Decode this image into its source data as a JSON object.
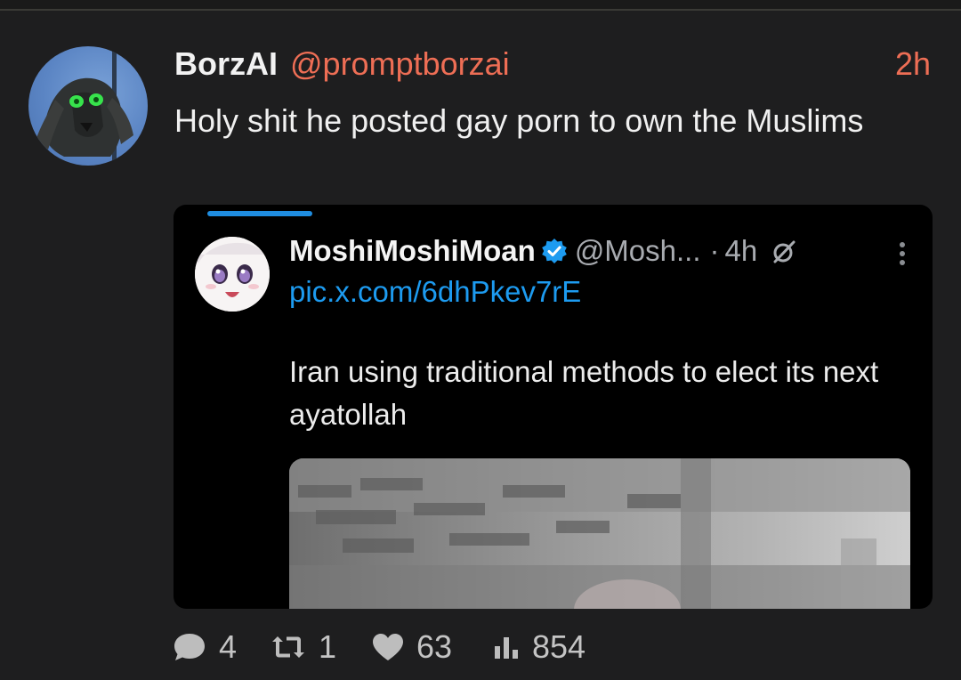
{
  "post": {
    "author": {
      "display_name": "BorzAI",
      "handle": "@promptborzai"
    },
    "timestamp": "2h",
    "text": "Holy shit he posted gay porn to own the Muslims",
    "embed": {
      "author": {
        "display_name": "MoshiMoshiMoan",
        "handle": "@Mosh...",
        "separator": "·",
        "time": "4h"
      },
      "link": "pic.x.com/6dhPkev7rE",
      "text": "Iran using traditional methods to elect its next ayatollah"
    },
    "stats": {
      "replies": "4",
      "reposts": "1",
      "likes": "63",
      "views": "854"
    }
  },
  "colors": {
    "background": "#1e1e1f",
    "accent": "#ee6e55",
    "link": "#1d9bf0",
    "verified": "#1d9bf0",
    "muted": "#bdbdbd"
  },
  "icons": [
    "avatar-image",
    "verified-badge-icon",
    "grok-icon",
    "more-options-icon",
    "reply-icon",
    "repost-icon",
    "like-icon",
    "views-icon"
  ]
}
